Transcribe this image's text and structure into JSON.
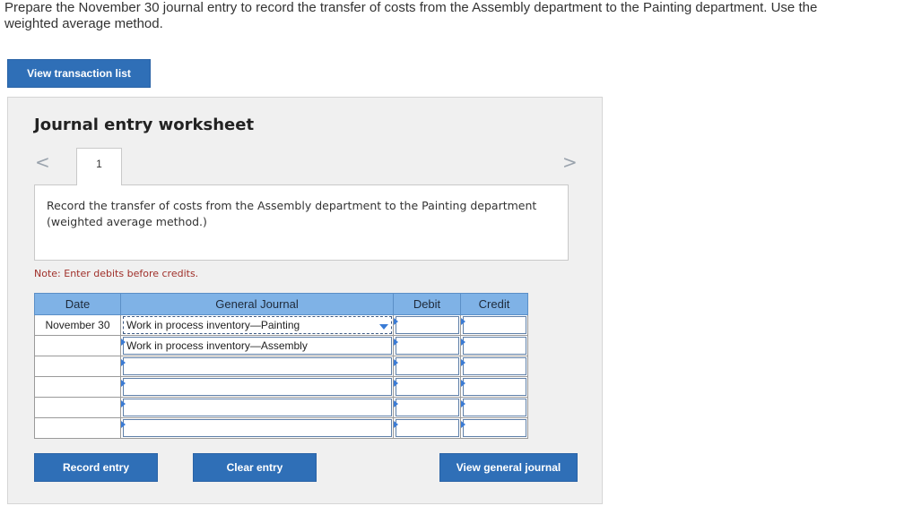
{
  "instructions": "Prepare the November 30 journal entry to record the transfer of costs from the Assembly department to the Painting department. Use the weighted average method.",
  "buttons": {
    "view_transaction_list": "View transaction list",
    "record_entry": "Record entry",
    "clear_entry": "Clear entry",
    "view_general_journal": "View general journal"
  },
  "worksheet": {
    "title": "Journal entry worksheet",
    "nav_prev": "<",
    "nav_next": ">",
    "tab_label": "1",
    "description": "Record the transfer of costs from the Assembly department to the Painting department (weighted average method.)",
    "note": "Note: Enter debits before credits."
  },
  "journal": {
    "headers": {
      "date": "Date",
      "general_journal": "General Journal",
      "debit": "Debit",
      "credit": "Credit"
    },
    "rows": [
      {
        "date": "November 30",
        "account": "Work in process inventory—Painting",
        "debit": "",
        "credit": ""
      },
      {
        "date": "",
        "account": "Work in process inventory—Assembly",
        "debit": "",
        "credit": ""
      },
      {
        "date": "",
        "account": "",
        "debit": "",
        "credit": ""
      },
      {
        "date": "",
        "account": "",
        "debit": "",
        "credit": ""
      },
      {
        "date": "",
        "account": "",
        "debit": "",
        "credit": ""
      },
      {
        "date": "",
        "account": "",
        "debit": "",
        "credit": ""
      }
    ]
  },
  "colors": {
    "button_blue": "#2f6fb7",
    "header_blue": "#7fb2e6",
    "note_red": "#a0302a"
  }
}
